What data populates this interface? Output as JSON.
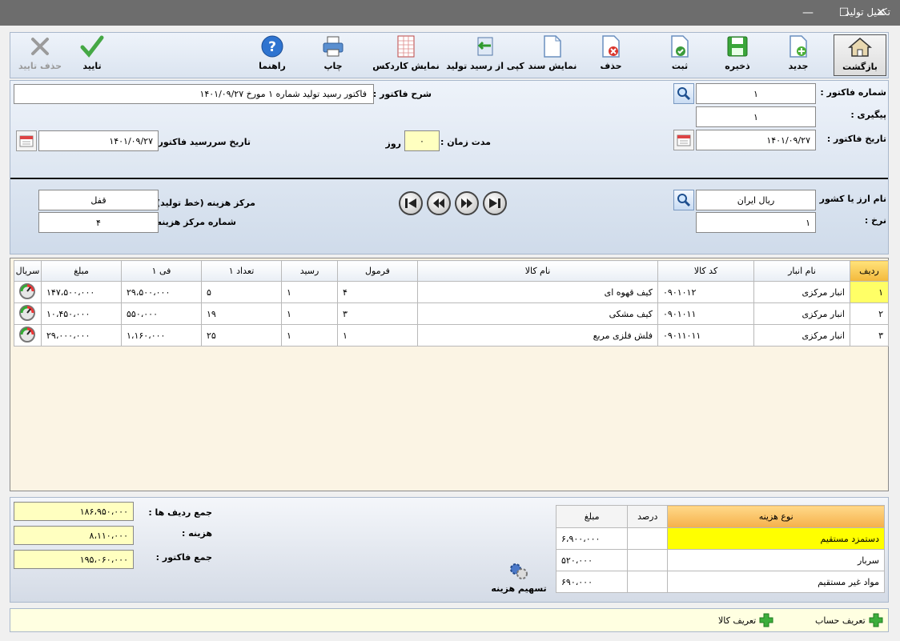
{
  "window": {
    "title": "تکمیل تولید",
    "minimize": "—",
    "maximize": "☐",
    "close": "✕"
  },
  "toolbar": {
    "back": "بازگشت",
    "new": "جدید",
    "save": "ذخیره",
    "register": "ثبت",
    "delete": "حذف",
    "show_doc": "نمایش سند",
    "copy_from_receipt": "کپی از رسید تولید",
    "show_kardex": "نمایش کاردکس",
    "print": "چاپ",
    "help": "راهنما",
    "confirm": "تایید",
    "remove_confirm": "حذف تایید"
  },
  "header": {
    "invoice_number_label": "شماره فاکتور :",
    "invoice_number": "۱",
    "followup_label": "پیگیری :",
    "followup": "۱",
    "invoice_date_label": "تاریخ فاکتور :",
    "invoice_date": "۱۴۰۱/۰۹/۲۷",
    "description_label": "شرح فاکتور :",
    "description": "فاکتور رسید تولید شماره ۱ مورخ ۱۴۰۱/۰۹/۲۷",
    "duration_label": "مدت زمان :",
    "duration": "۰",
    "duration_unit": "روز",
    "due_date_label": "تاریخ سررسید فاکتور :",
    "due_date": "۱۴۰۱/۰۹/۲۷",
    "currency_label": "نام ارز یا کشور :",
    "currency": "ریال ایران",
    "rate_label": "نرخ :",
    "rate": "۱",
    "cost_center_label": "مرکز هزینه (خط تولید) :",
    "cost_center": "قفل",
    "cost_center_no_label": "شماره مرکز هزینه :",
    "cost_center_no": "۴"
  },
  "grid": {
    "columns": [
      "ردیف",
      "نام انبار",
      "کد کالا",
      "نام کالا",
      "فرمول",
      "رسید",
      "تعداد ۱",
      "فی ۱",
      "مبلغ",
      "سریال"
    ],
    "rows": [
      {
        "row": "۱",
        "warehouse": "انبار مرکزی",
        "code": "۰۹۰۱۰۱۲",
        "name": "کیف قهوه ای",
        "formula": "۴",
        "receipt": "۱",
        "qty": "۵",
        "price": "۲۹،۵۰۰،۰۰۰",
        "amount": "۱۴۷،۵۰۰،۰۰۰"
      },
      {
        "row": "۲",
        "warehouse": "انبار مرکزی",
        "code": "۰۹۰۱۰۱۱",
        "name": "کیف مشکی",
        "formula": "۳",
        "receipt": "۱",
        "qty": "۱۹",
        "price": "۵۵۰،۰۰۰",
        "amount": "۱۰،۴۵۰،۰۰۰"
      },
      {
        "row": "۳",
        "warehouse": "انبار مرکزی",
        "code": "۰۹۰۱۱۰۱۱",
        "name": "فلش فلزی مربع",
        "formula": "۱",
        "receipt": "۱",
        "qty": "۲۵",
        "price": "۱،۱۶۰،۰۰۰",
        "amount": "۲۹،۰۰۰،۰۰۰"
      }
    ]
  },
  "totals": {
    "rows_total_label": "جمع ردیف ها :",
    "rows_total": "۱۸۶،۹۵۰،۰۰۰",
    "cost_label": "هزینه :",
    "cost": "۸،۱۱۰،۰۰۰",
    "invoice_total_label": "جمع فاکتور :",
    "invoice_total": "۱۹۵،۰۶۰،۰۰۰",
    "allocate_label": "تسهیم هزینه"
  },
  "costs": {
    "columns": [
      "نوع هزینه",
      "درصد",
      "مبلغ"
    ],
    "rows": [
      {
        "type": "دستمزد مستقیم",
        "percent": "",
        "amount": "۶،۹۰۰،۰۰۰"
      },
      {
        "type": "سربار",
        "percent": "",
        "amount": "۵۲۰،۰۰۰"
      },
      {
        "type": "مواد غیر مستقیم",
        "percent": "",
        "amount": "۶۹۰،۰۰۰"
      }
    ]
  },
  "bottom": {
    "define_account": "تعریف حساب",
    "define_item": "تعریف کالا"
  }
}
